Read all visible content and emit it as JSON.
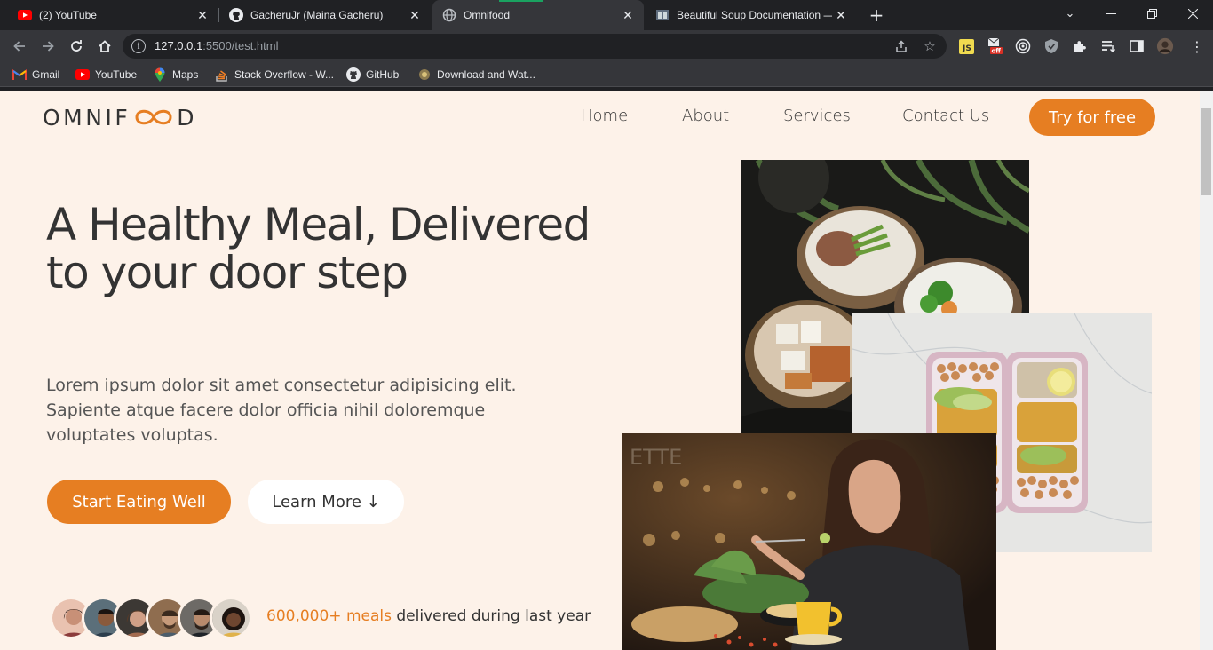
{
  "browser": {
    "tabs": [
      {
        "title": "(2) YouTube",
        "favicon": "youtube-icon"
      },
      {
        "title": "GacheruJr (Maina Gacheru)",
        "favicon": "github-icon"
      },
      {
        "title": "Omnifood",
        "favicon": "globe-icon",
        "active": true
      },
      {
        "title": "Beautiful Soup Documentation —",
        "favicon": "document-icon"
      }
    ],
    "url_host": "127.0.0.1",
    "url_rest": ":5500/test.html",
    "bookmarks": [
      {
        "label": "Gmail",
        "icon": "gmail-icon"
      },
      {
        "label": "YouTube",
        "icon": "youtube-icon"
      },
      {
        "label": "Maps",
        "icon": "maps-icon"
      },
      {
        "label": "Stack Overflow - W...",
        "icon": "stackoverflow-icon"
      },
      {
        "label": "GitHub",
        "icon": "github-icon"
      },
      {
        "label": "Download and Wat...",
        "icon": "download-site-icon"
      }
    ],
    "extension_badge": "off"
  },
  "page": {
    "logo": {
      "left": "OMNIF",
      "right": "D"
    },
    "nav": [
      "Home",
      "About",
      "Services",
      "Contact Us"
    ],
    "nav_cta": "Try for free",
    "hero": {
      "title": "A Healthy Meal, Delivered to your door step",
      "description": "Lorem ipsum dolor sit amet consectetur adipisicing elit. Sapiente atque facere dolor officia nihil doloremque voluptates voluptas.",
      "primary_button": "Start Eating Well",
      "secondary_button": "Learn More ↓"
    },
    "delivered": {
      "highlight": "600,000+ meals",
      "text": " delivered during last year"
    }
  },
  "colors": {
    "accent": "#e67e22",
    "background": "#fdf2e9",
    "text": "#333333"
  }
}
